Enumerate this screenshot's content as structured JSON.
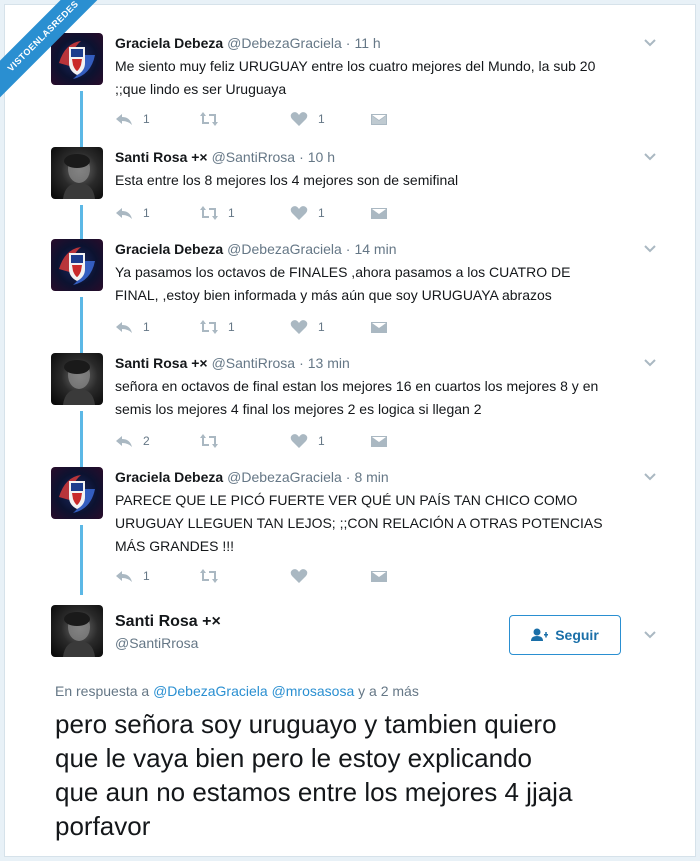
{
  "watermark": "VISTOENLASREDES",
  "colors": {
    "accent": "#2a8fd1",
    "thread_line": "#5cb8e6",
    "muted": "#657786",
    "icon": "#aab8c2"
  },
  "thread": [
    {
      "name": "Graciela Debeza",
      "handle": "@DebezaGraciela",
      "time": "11 h",
      "avatar": "graciela-avatar",
      "lines": [
        "Me siento muy feliz URUGUAY entre los cuatro mejores del Mundo, la sub 20",
        ";;que lindo es ser Uruguaya"
      ],
      "replies": "1",
      "retweets": "",
      "likes": "1"
    },
    {
      "name": "Santi Rosa +×",
      "handle": "@SantiRrosa",
      "time": "10 h",
      "avatar": "santi-avatar",
      "lines": [
        "Esta entre los 8 mejores los 4 mejores son de semifinal"
      ],
      "replies": "1",
      "retweets": "1",
      "likes": "1"
    },
    {
      "name": "Graciela Debeza",
      "handle": "@DebezaGraciela",
      "time": "14 min",
      "avatar": "graciela-avatar",
      "lines": [
        "Ya pasamos los octavos de FINALES ,ahora pasamos a los CUATRO DE",
        "FINAL, ,estoy bien informada y más aún que soy URUGUAYA abrazos"
      ],
      "replies": "1",
      "retweets": "1",
      "likes": "1"
    },
    {
      "name": "Santi Rosa +×",
      "handle": "@SantiRrosa",
      "time": "13 min",
      "avatar": "santi-avatar",
      "lines": [
        "señora en octavos de final estan los mejores 16 en cuartos los mejores 8 y en",
        "semis los mejores 4 final los mejores 2 es logica si llegan 2"
      ],
      "replies": "2",
      "retweets": "",
      "likes": "1"
    },
    {
      "name": "Graciela Debeza",
      "handle": "@DebezaGraciela",
      "time": "8 min",
      "avatar": "graciela-avatar",
      "lines": [
        "PARECE QUE LE PICÓ FUERTE VER QUÉ UN PAÍS TAN CHICO COMO",
        "URUGUAY LLEGUEN TAN LEJOS; ;;CON RELACIÓN A OTRAS POTENCIAS",
        "MÁS GRANDES !!!"
      ],
      "replies": "1",
      "retweets": "",
      "likes": ""
    }
  ],
  "main": {
    "name": "Santi Rosa +×",
    "handle": "@SantiRrosa",
    "follow_label": "Seguir",
    "reply_prefix": "En respuesta a",
    "reply_link1": "@DebezaGraciela",
    "reply_link2": "@mrosasosa",
    "reply_suffix": "y a 2 más",
    "lines": [
      "pero señora soy uruguayo y tambien quiero",
      "que le vaya bien pero le estoy explicando",
      "que aun no estamos entre los mejores 4 jjaja",
      "porfavor"
    ]
  }
}
